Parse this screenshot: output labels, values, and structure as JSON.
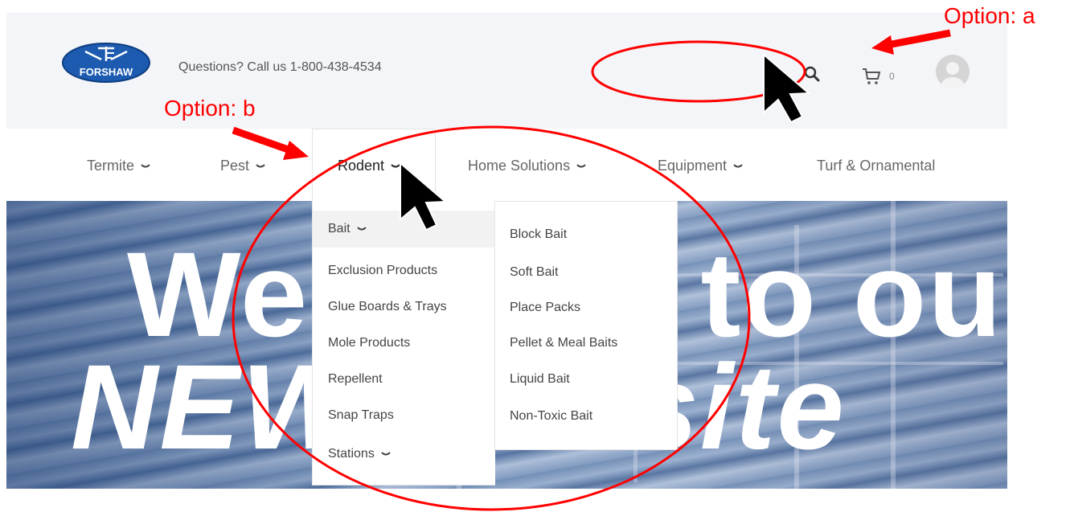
{
  "header": {
    "logo_text": "FORSHAW",
    "phone_text": "Questions? Call us 1-800-438-4534",
    "cart_count": "0",
    "icons": [
      "search-icon",
      "cart-icon",
      "user-avatar-icon"
    ]
  },
  "nav": {
    "items": [
      {
        "label": "Termite",
        "has_dropdown": true
      },
      {
        "label": "Pest",
        "has_dropdown": true
      },
      {
        "label": "Rodent",
        "has_dropdown": true
      },
      {
        "label": "Home Solutions",
        "has_dropdown": true
      },
      {
        "label": "Equipment",
        "has_dropdown": true
      },
      {
        "label": "Turf & Ornamental",
        "has_dropdown": false
      }
    ],
    "active": "Rodent"
  },
  "dropdown": {
    "categories": [
      {
        "label": "Bait",
        "has_submenu": true
      },
      {
        "label": "Exclusion Products",
        "has_submenu": false
      },
      {
        "label": "Glue Boards & Trays",
        "has_submenu": false
      },
      {
        "label": "Mole Products",
        "has_submenu": false
      },
      {
        "label": "Repellent",
        "has_submenu": false
      },
      {
        "label": "Snap Traps",
        "has_submenu": false
      },
      {
        "label": "Stations",
        "has_submenu": true
      }
    ],
    "highlighted": "Bait",
    "subitems": [
      "Block Bait",
      "Soft Bait",
      "Place Packs",
      "Pellet & Meal Baits",
      "Liquid Bait",
      "Non-Toxic Bait"
    ]
  },
  "hero": {
    "line1": "Welcome to our",
    "line2": "NEW website"
  },
  "annotations": {
    "option_a": "Option: a",
    "option_b": "Option: b",
    "color": "#ff0000"
  },
  "colors": {
    "header_bg": "#f4f5f9",
    "logo_blue": "#1c5bb0",
    "annotation_red": "#ff0000"
  }
}
